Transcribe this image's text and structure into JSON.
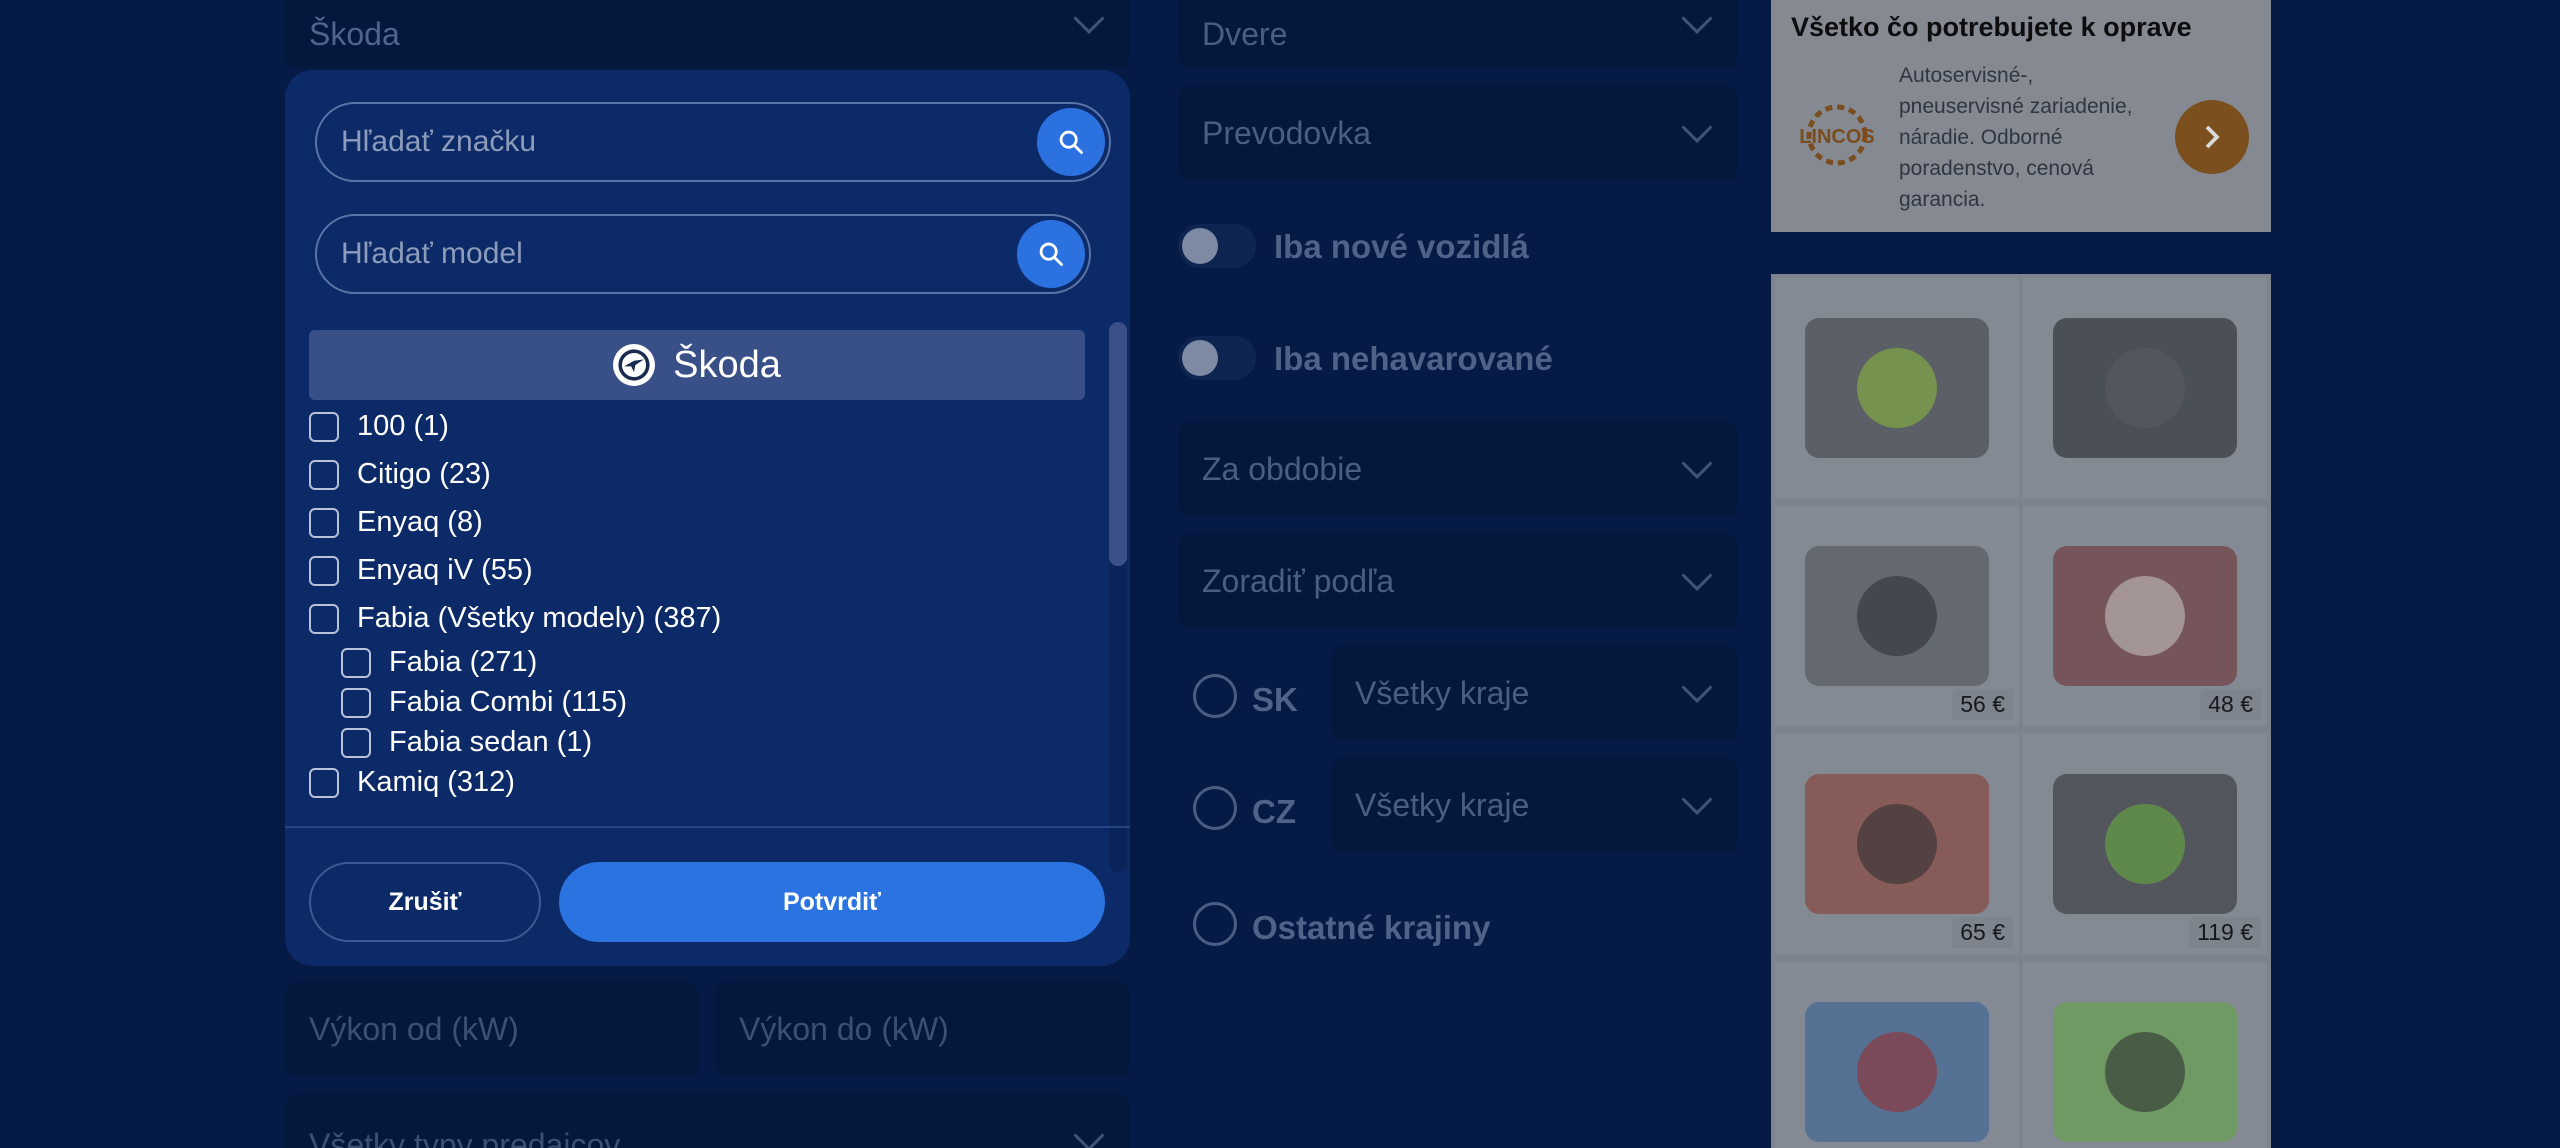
{
  "left_form": {
    "brand_select": "Škoda",
    "power_from_placeholder": "Výkon od (kW)",
    "power_to_placeholder": "Výkon do (kW)",
    "seller_types": "Všetky typy predajcov"
  },
  "modal": {
    "brand_search_placeholder": "Hľadať značku",
    "model_search_placeholder": "Hľadať model",
    "selected_brand": "Škoda",
    "models": [
      {
        "label": "100 (1)",
        "indent": false
      },
      {
        "label": "Citigo (23)",
        "indent": false
      },
      {
        "label": "Enyaq (8)",
        "indent": false
      },
      {
        "label": "Enyaq iV (55)",
        "indent": false
      },
      {
        "label": "Fabia (Všetky modely) (387)",
        "indent": false
      },
      {
        "label": "Fabia (271)",
        "indent": true
      },
      {
        "label": "Fabia Combi (115)",
        "indent": true
      },
      {
        "label": "Fabia sedan (1)",
        "indent": true
      },
      {
        "label": "Kamiq (312)",
        "indent": false
      }
    ],
    "cancel_label": "Zrušiť",
    "confirm_label": "Potvrdiť"
  },
  "middle_form": {
    "doors": "Dvere",
    "transmission": "Prevodovka",
    "toggle_new": "Iba nové vozidlá",
    "toggle_undamaged": "Iba nehavarované",
    "period": "Za obdobie",
    "sort_by": "Zoradiť podľa",
    "region_sk_label": "SK",
    "region_sk_select": "Všetky kraje",
    "region_cz_label": "CZ",
    "region_cz_select": "Všetky kraje",
    "other_countries": "Ostatné krajiny"
  },
  "ads": {
    "top": {
      "title": "Všetko čo potrebujete k oprave",
      "text": "Autoservisné-, pneuservisné zariadenie, náradie. Odborné poradenstvo, cenová garancia.",
      "logo": "LINCOS"
    },
    "tiles": [
      {
        "price": ""
      },
      {
        "price": ""
      },
      {
        "price": "56 €"
      },
      {
        "price": "48 €"
      },
      {
        "price": "65 €"
      },
      {
        "price": "119 €"
      },
      {
        "price": ""
      },
      {
        "price": ""
      }
    ]
  }
}
